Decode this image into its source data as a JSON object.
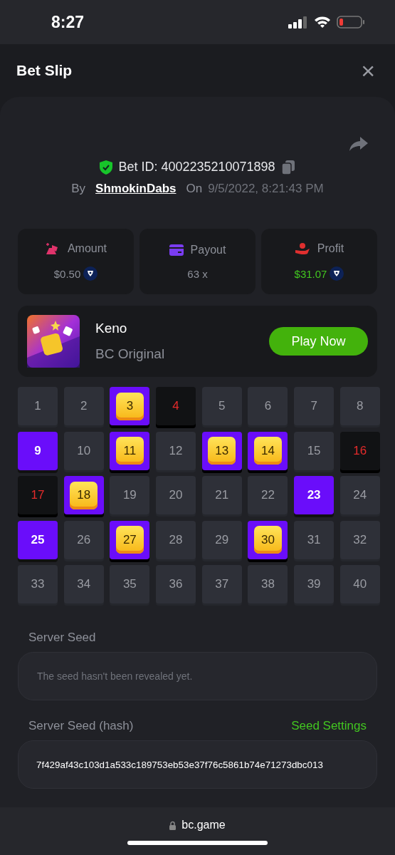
{
  "status_bar": {
    "time": "8:27"
  },
  "header": {
    "title": "Bet Slip",
    "close": "×"
  },
  "bet": {
    "id": "Bet ID: 4002235210071898",
    "verified": true,
    "by_label": "By",
    "user": "ShmokinDabs",
    "on_label": "On",
    "date": "9/5/2022, 8:21:43 PM"
  },
  "stats": [
    {
      "kind": "amount",
      "label": "Amount",
      "value": "$0.50",
      "coin": true,
      "highlight": false
    },
    {
      "kind": "payout",
      "label": "Payout",
      "value": "63 x",
      "coin": false,
      "highlight": false
    },
    {
      "kind": "profit",
      "label": "Profit",
      "value": "$31.07",
      "coin": true,
      "highlight": true
    }
  ],
  "game": {
    "name": "Keno",
    "subtitle": "BC Original",
    "button": "Play Now"
  },
  "tiles": [
    {
      "number": "1",
      "selected": false,
      "drawn": false
    },
    {
      "number": "2",
      "selected": false,
      "drawn": false
    },
    {
      "number": "3",
      "selected": true,
      "drawn": true
    },
    {
      "number": "4",
      "selected": false,
      "drawn": true
    },
    {
      "number": "5",
      "selected": false,
      "drawn": false
    },
    {
      "number": "6",
      "selected": false,
      "drawn": false
    },
    {
      "number": "7",
      "selected": false,
      "drawn": false
    },
    {
      "number": "8",
      "selected": false,
      "drawn": false
    },
    {
      "number": "9",
      "selected": true,
      "drawn": false
    },
    {
      "number": "10",
      "selected": false,
      "drawn": false
    },
    {
      "number": "11",
      "selected": true,
      "drawn": true
    },
    {
      "number": "12",
      "selected": false,
      "drawn": false
    },
    {
      "number": "13",
      "selected": true,
      "drawn": true
    },
    {
      "number": "14",
      "selected": true,
      "drawn": true
    },
    {
      "number": "15",
      "selected": false,
      "drawn": false
    },
    {
      "number": "16",
      "selected": false,
      "drawn": true
    },
    {
      "number": "17",
      "selected": false,
      "drawn": true
    },
    {
      "number": "18",
      "selected": true,
      "drawn": true
    },
    {
      "number": "19",
      "selected": false,
      "drawn": false
    },
    {
      "number": "20",
      "selected": false,
      "drawn": false
    },
    {
      "number": "21",
      "selected": false,
      "drawn": false
    },
    {
      "number": "22",
      "selected": false,
      "drawn": false
    },
    {
      "number": "23",
      "selected": true,
      "drawn": false
    },
    {
      "number": "24",
      "selected": false,
      "drawn": false
    },
    {
      "number": "25",
      "selected": true,
      "drawn": false
    },
    {
      "number": "26",
      "selected": false,
      "drawn": false
    },
    {
      "number": "27",
      "selected": true,
      "drawn": true
    },
    {
      "number": "28",
      "selected": false,
      "drawn": false
    },
    {
      "number": "29",
      "selected": false,
      "drawn": false
    },
    {
      "number": "30",
      "selected": true,
      "drawn": true
    },
    {
      "number": "31",
      "selected": false,
      "drawn": false
    },
    {
      "number": "32",
      "selected": false,
      "drawn": false
    },
    {
      "number": "33",
      "selected": false,
      "drawn": false
    },
    {
      "number": "34",
      "selected": false,
      "drawn": false
    },
    {
      "number": "35",
      "selected": false,
      "drawn": false
    },
    {
      "number": "36",
      "selected": false,
      "drawn": false
    },
    {
      "number": "37",
      "selected": false,
      "drawn": false
    },
    {
      "number": "38",
      "selected": false,
      "drawn": false
    },
    {
      "number": "39",
      "selected": false,
      "drawn": false
    },
    {
      "number": "40",
      "selected": false,
      "drawn": false
    }
  ],
  "server_seed": {
    "label": "Server Seed",
    "placeholder": "The seed hasn't been revealed yet."
  },
  "server_seed_hash": {
    "label": "Server Seed (hash)",
    "link": "Seed Settings",
    "value": "7f429af43c103d1a533c189753eb53e37f76c5861b74e71273dbc013"
  },
  "browser_bar": {
    "url": "bc.game"
  }
}
